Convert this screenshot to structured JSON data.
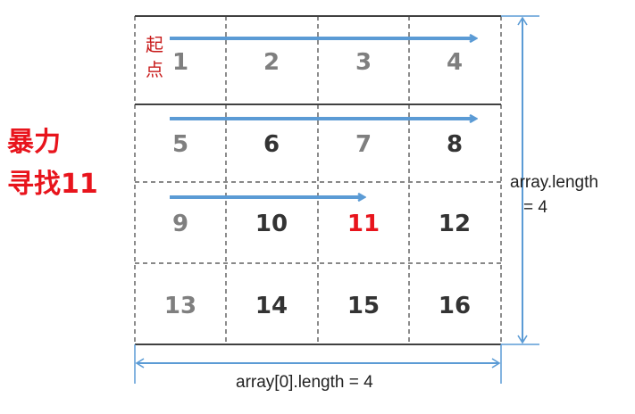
{
  "title": {
    "line1": "暴力",
    "line2_text": "寻找",
    "line2_number": "11"
  },
  "start_label": {
    "char1": "起",
    "char2": "点"
  },
  "matrix": {
    "rows": [
      [
        "1",
        "2",
        "3",
        "4"
      ],
      [
        "5",
        "6",
        "7",
        "8"
      ],
      [
        "9",
        "10",
        "11",
        "12"
      ],
      [
        "13",
        "14",
        "15",
        "16"
      ]
    ],
    "target": "11",
    "target_row": 2,
    "target_col": 2
  },
  "dimensions": {
    "rows_label_line1": "array.length",
    "rows_label_line2": "= 4",
    "cols_label": "array[0].length = 4"
  },
  "colors": {
    "accent_red": "#e8141c",
    "start_red": "#c81a1a",
    "arrow_blue": "#5b9bd5",
    "grid_line": "#404040",
    "number_gray": "#7f7f7f",
    "number_dark": "#333333"
  },
  "icons": {
    "scan_arrow": "right-arrow-icon",
    "dimension_arrow": "double-headed-arrow-icon"
  }
}
